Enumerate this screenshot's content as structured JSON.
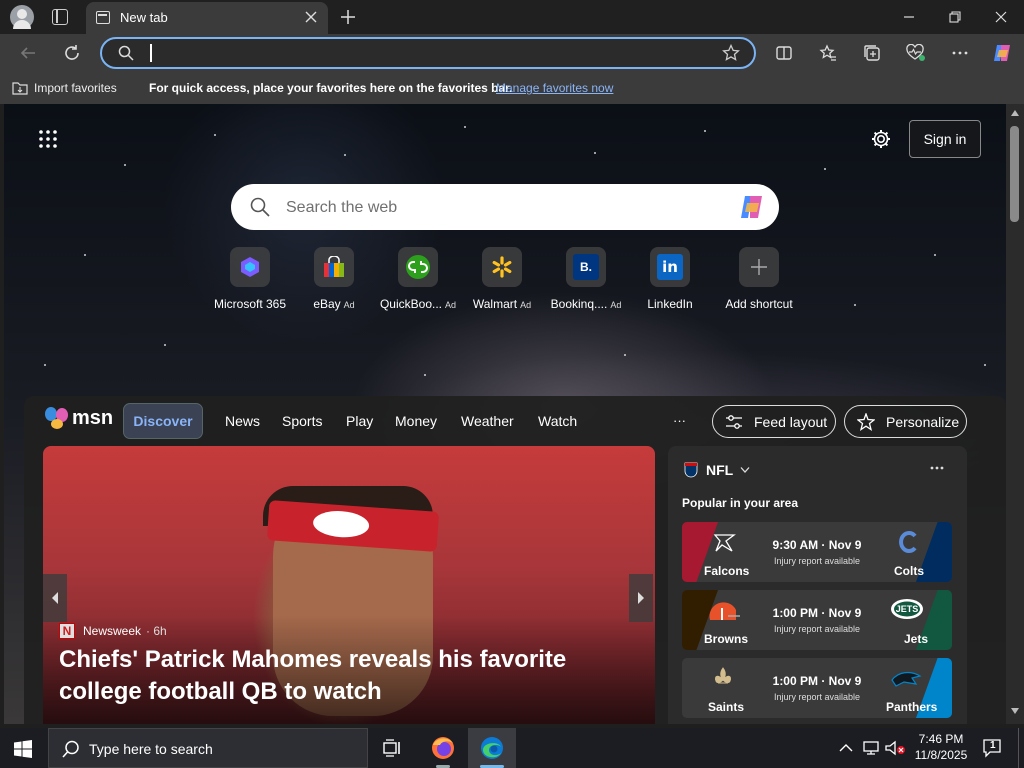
{
  "browser": {
    "tab_title": "New tab",
    "address_value": "",
    "favorites_bar": {
      "import_label": "Import favorites",
      "message": "For quick access, place your favorites here on the favorites bar.",
      "manage_link": "Manage favorites now"
    }
  },
  "ntp": {
    "sign_in_label": "Sign in",
    "search_placeholder": "Search the web",
    "shortcuts": [
      {
        "label": "Microsoft 365",
        "ad": ""
      },
      {
        "label": "eBay",
        "ad": "Ad"
      },
      {
        "label": "QuickBoo...",
        "ad": "Ad"
      },
      {
        "label": "Walmart",
        "ad": "Ad"
      },
      {
        "label": "Bookinq....",
        "ad": "Ad"
      },
      {
        "label": "LinkedIn",
        "ad": ""
      },
      {
        "label": "Add shortcut",
        "ad": ""
      }
    ]
  },
  "feed": {
    "logo_text": "msn",
    "nav": [
      "Discover",
      "News",
      "Sports",
      "Play",
      "Money",
      "Weather",
      "Watch"
    ],
    "more_label": "···",
    "feed_layout_label": "Feed layout",
    "personalize_label": "Personalize",
    "hero": {
      "source": "Newsweek",
      "age": "· 6h",
      "headline": "Chiefs' Patrick Mahomes reveals his favorite college football QB to watch"
    },
    "nfl": {
      "title": "NFL",
      "subtitle": "Popular in your area",
      "games": [
        {
          "home": "Falcons",
          "away": "Colts",
          "time": "9:30 AM · Nov 9",
          "note": "Injury report available",
          "home_color": "#a71930",
          "away_color": "#002c5f"
        },
        {
          "home": "Browns",
          "away": "Jets",
          "time": "1:00 PM · Nov 9",
          "note": "Injury report available",
          "home_color": "#311d00",
          "away_color": "#125740"
        },
        {
          "home": "Saints",
          "away": "Panthers",
          "time": "1:00 PM · Nov 9",
          "note": "Injury report available",
          "home_color": "#2a2a2a",
          "away_color": "#0085ca"
        }
      ]
    }
  },
  "taskbar": {
    "search_placeholder": "Type here to search",
    "time": "7:46 PM",
    "date": "11/8/2025",
    "notification_count": "1"
  }
}
